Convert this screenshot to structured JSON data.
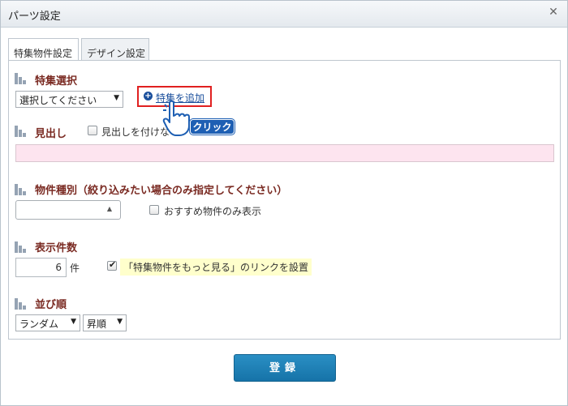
{
  "dialog": {
    "title": "パーツ設定",
    "close_icon": "close-icon"
  },
  "tabs": [
    {
      "label": "特集物件設定",
      "active": true
    },
    {
      "label": "デザイン設定",
      "active": false
    }
  ],
  "sections": {
    "feature": {
      "title": "特集選択",
      "select_value": "選択してください",
      "add_link": "特集を追加",
      "click_badge": "クリック"
    },
    "heading": {
      "title": "見出し",
      "checkbox_label": "見出しを付けな",
      "checked": false,
      "input_value": ""
    },
    "property_type": {
      "title": "物件種別（絞り込みたい場合のみ指定してください）",
      "select_value": "",
      "checkbox_label": "おすすめ物件のみ表示",
      "checked": false
    },
    "count": {
      "title": "表示件数",
      "value": "6",
      "unit": "件",
      "checkbox_label": "「特集物件をもっと見る」のリンクを設置",
      "checked": true
    },
    "order": {
      "title": "並び順",
      "sort_value": "ランダム",
      "direction_value": "昇順"
    }
  },
  "footer": {
    "register_label": "登録"
  },
  "colors": {
    "section_title": "#7a2a22",
    "link": "#1a4f9c",
    "highlight_box": "#e02020",
    "pink_input": "#fde4ef",
    "register_button": "#1f80b8",
    "click_badge": "#1e5fb3"
  }
}
